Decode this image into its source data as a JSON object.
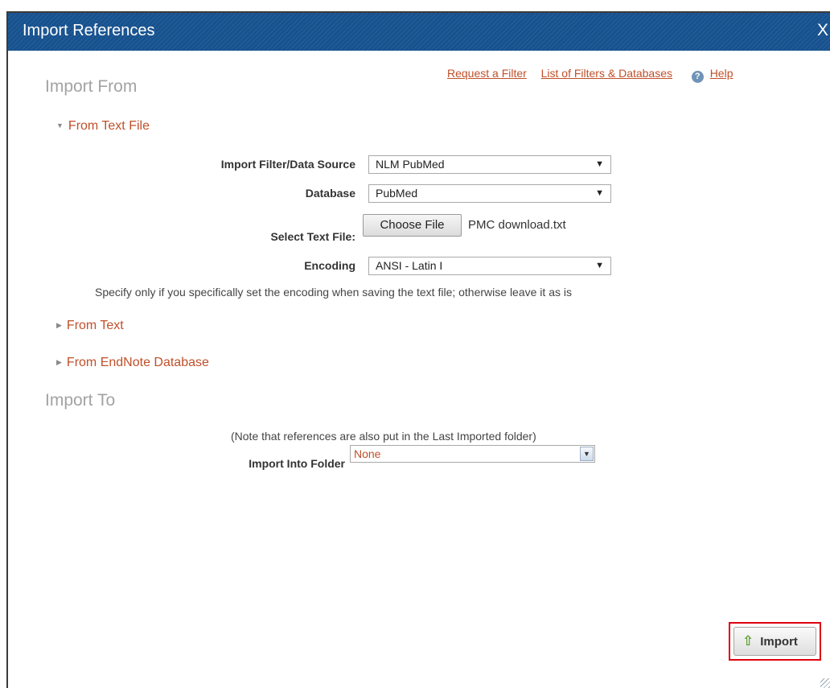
{
  "dialog": {
    "title": "Import References",
    "close_label": "X"
  },
  "import_from": {
    "heading": "Import From",
    "links": {
      "request_filter": "Request a Filter",
      "filters_databases": "List of Filters & Databases",
      "help_icon": "?",
      "help": "Help"
    },
    "from_text_file": {
      "label": "From Text File",
      "expanded": true,
      "import_filter_label": "Import Filter/Data Source",
      "import_filter_value": "NLM PubMed",
      "database_label": "Database",
      "database_value": "PubMed",
      "select_file_label": "Select Text File:",
      "choose_file_button": "Choose File",
      "file_name": "PMC download.txt",
      "encoding_label": "Encoding",
      "encoding_value": "ANSI - Latin I",
      "encoding_note": "Specify only if you specifically set the encoding when saving the text file; otherwise leave it as is"
    },
    "from_text": {
      "label": "From Text",
      "expanded": false
    },
    "from_endnote": {
      "label": "From EndNote Database",
      "expanded": false
    }
  },
  "import_to": {
    "heading": "Import To",
    "note": "(Note that references are also put in the Last Imported folder)",
    "folder_label": "Import Into Folder",
    "folder_value": "None"
  },
  "actions": {
    "import_button": "Import"
  },
  "colors": {
    "titlebar": "#17528f",
    "link": "#c0502a",
    "highlight": "#e0000f"
  },
  "icons": {
    "expanded": "triangle-down-icon",
    "collapsed": "triangle-right-icon",
    "help": "help-icon",
    "import": "up-arrow-icon"
  }
}
